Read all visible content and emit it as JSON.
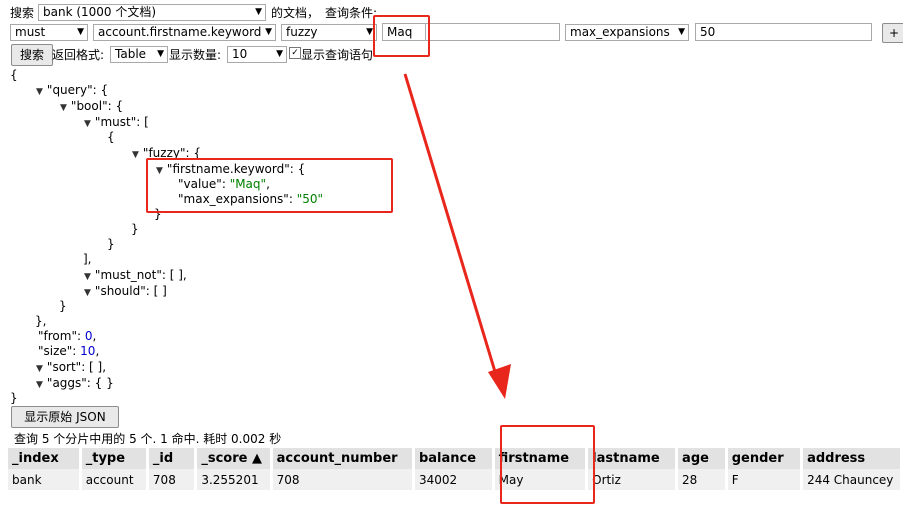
{
  "search_row": {
    "search_label": "搜索",
    "index_select": "bank (1000 个文档)",
    "docs_label": "的文档，",
    "query_cond_label": "查询条件:"
  },
  "query_row": {
    "bool_select": "must",
    "field_select": "account.firstname.keyword",
    "type_select": "fuzzy",
    "value_input": "Maq",
    "extra_input": "",
    "option_select": "max_expansions",
    "option_input": "50",
    "add_label": "+"
  },
  "options_row": {
    "search_button": "搜索",
    "return_format_label": "返回格式:",
    "format_select": "Table",
    "display_count_label": "显示数量:",
    "count_select": "10",
    "show_query_label": "显示查询语句"
  },
  "json": {
    "open": "{",
    "query_key": "\"query\": {",
    "bool_key": "\"bool\": {",
    "must_key": "\"must\": [",
    "obj_open": "{",
    "fuzzy_key": "\"fuzzy\": {",
    "field_key": "\"firstname.keyword\": {",
    "value_key": "\"value\": ",
    "value_val": "\"Maq\"",
    "maxexp_key": "\"max_expansions\": ",
    "maxexp_val": "\"50\"",
    "close_brace": "}",
    "close_bracket_comma": "],",
    "must_not": "\"must_not\": [ ],",
    "should": "\"should\": [ ]",
    "close_brace_comma": "},",
    "from_key": "\"from\": ",
    "from_val": "0",
    "size_key": "\"size\": ",
    "size_val": "10",
    "sort": "\"sort\": [ ],",
    "aggs": "\"aggs\": { }",
    "comma": ",",
    "final_close": "}"
  },
  "raw_json_button": "显示原始 JSON",
  "summary": "查询 5 个分片中用的 5 个. 1 命中. 耗时 0.002 秒",
  "table": {
    "headers": [
      "_index",
      "_type",
      "_id",
      "_score ▲",
      "account_number",
      "balance",
      "firstname",
      "lastname",
      "age",
      "gender",
      "address"
    ],
    "rows": [
      [
        "bank",
        "account",
        "708",
        "3.255201",
        "708",
        "34002",
        "May",
        "Ortiz",
        "28",
        "F",
        "244 Chauncey"
      ]
    ]
  },
  "colors": {
    "annotation": "#e8261c",
    "json_string": "#008000",
    "json_number": "#0000cc"
  },
  "icons": [
    "dropdown-caret-icon",
    "expand-triangle-icon",
    "checkbox-icon"
  ]
}
